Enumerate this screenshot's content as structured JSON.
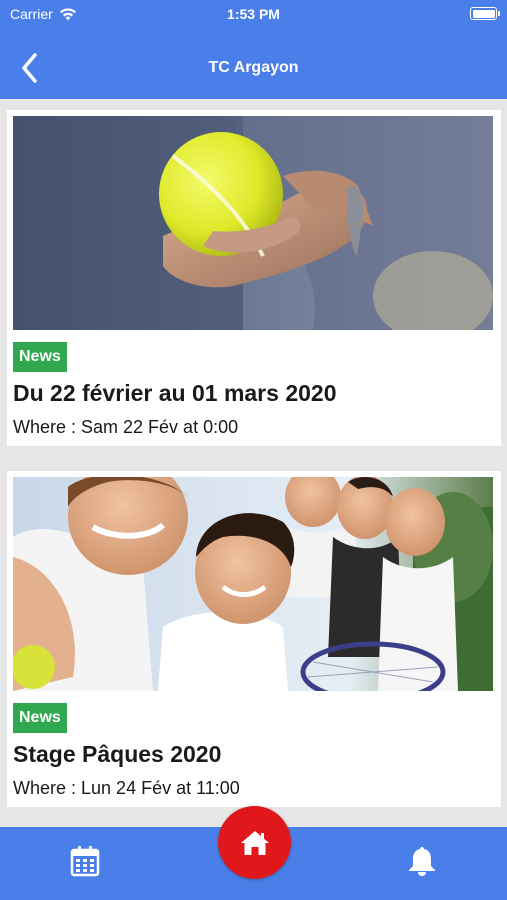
{
  "status_bar": {
    "carrier": "Carrier",
    "time": "1:53 PM"
  },
  "nav": {
    "title": "TC Argayon",
    "back_icon": "chevron-left-icon"
  },
  "cards": [
    {
      "image": "tennis-ball-hand-photo",
      "badge": "News",
      "title": "Du 22 février au 01 mars 2020",
      "where": "Where : Sam 22 Fév at 0:00"
    },
    {
      "image": "family-tennis-photo",
      "badge": "News",
      "title": "Stage Pâques 2020",
      "where": "Where : Lun 24 Fév at 11:00"
    }
  ],
  "tab_bar": {
    "left_icon": "calendar-icon",
    "center_icon": "home-icon",
    "right_icon": "bell-icon"
  },
  "colors": {
    "primary": "#4a7fea",
    "badge": "#2fa84f",
    "home_button": "#e0171b"
  }
}
